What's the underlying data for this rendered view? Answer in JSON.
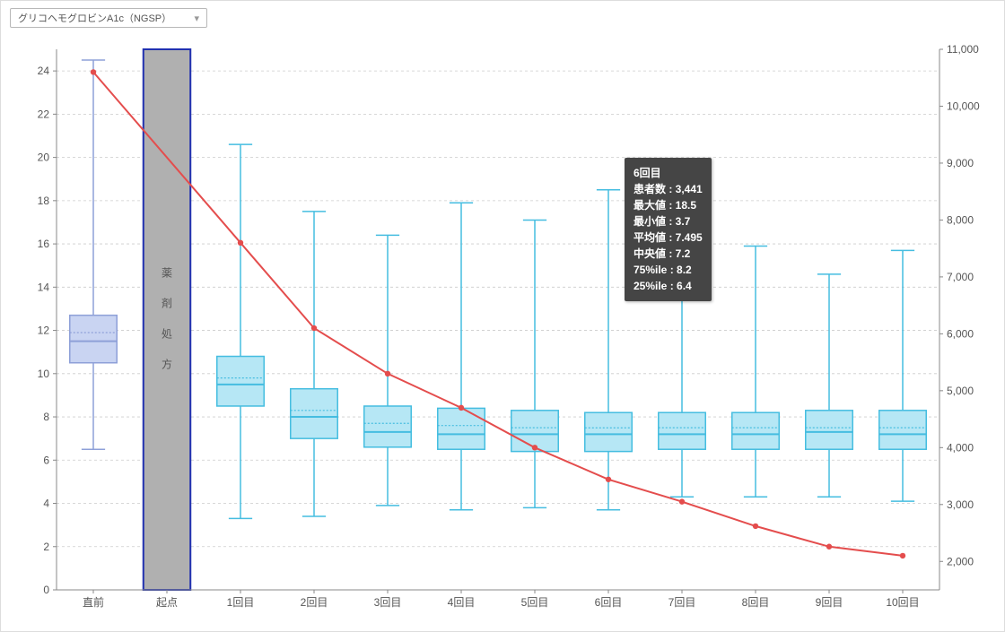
{
  "dropdown": {
    "selected": "グリコヘモグロビンA1c（NGSP）"
  },
  "chart_data": {
    "type": "boxplot+line",
    "x_categories": [
      "直前",
      "起点",
      "1回目",
      "2回目",
      "3回目",
      "4回目",
      "5回目",
      "6回目",
      "7回目",
      "8回目",
      "9回目",
      "10回目"
    ],
    "y1": {
      "label": "",
      "ylim": [
        0,
        25
      ],
      "ticks": [
        0,
        2,
        4,
        6,
        8,
        10,
        12,
        14,
        16,
        18,
        20,
        22,
        24
      ]
    },
    "y2": {
      "label": "",
      "ylim": [
        1500,
        11000
      ],
      "ticks": [
        2000,
        3000,
        4000,
        5000,
        6000,
        7000,
        8000,
        9000,
        10000,
        11000
      ],
      "tick_labels": [
        "2,000",
        "3,000",
        "4,000",
        "5,000",
        "6,000",
        "7,000",
        "8,000",
        "9,000",
        "10,000",
        "11,000"
      ]
    },
    "reference_band": {
      "category": "起点",
      "label": "薬剤処方"
    },
    "boxes": [
      {
        "cat": "直前",
        "min": 6.5,
        "q1": 10.5,
        "median": 11.5,
        "mean": 11.9,
        "q3": 12.7,
        "max": 24.5,
        "style": "pre"
      },
      {
        "cat": "1回目",
        "min": 3.3,
        "q1": 8.5,
        "median": 9.5,
        "mean": 9.8,
        "q3": 10.8,
        "max": 20.6,
        "style": "post"
      },
      {
        "cat": "2回目",
        "min": 3.4,
        "q1": 7.0,
        "median": 8.0,
        "mean": 8.3,
        "q3": 9.3,
        "max": 17.5,
        "style": "post"
      },
      {
        "cat": "3回目",
        "min": 3.9,
        "q1": 6.6,
        "median": 7.3,
        "mean": 7.7,
        "q3": 8.5,
        "max": 16.4,
        "style": "post"
      },
      {
        "cat": "4回目",
        "min": 3.7,
        "q1": 6.5,
        "median": 7.2,
        "mean": 7.6,
        "q3": 8.4,
        "max": 17.9,
        "style": "post"
      },
      {
        "cat": "5回目",
        "min": 3.8,
        "q1": 6.4,
        "median": 7.2,
        "mean": 7.5,
        "q3": 8.3,
        "max": 17.1,
        "style": "post"
      },
      {
        "cat": "6回目",
        "min": 3.7,
        "q1": 6.4,
        "median": 7.2,
        "mean": 7.495,
        "q3": 8.2,
        "max": 18.5,
        "style": "post"
      },
      {
        "cat": "7回目",
        "min": 4.3,
        "q1": 6.5,
        "median": 7.2,
        "mean": 7.5,
        "q3": 8.2,
        "max": 16.4,
        "style": "post"
      },
      {
        "cat": "8回目",
        "min": 4.3,
        "q1": 6.5,
        "median": 7.2,
        "mean": 7.5,
        "q3": 8.2,
        "max": 15.9,
        "style": "post"
      },
      {
        "cat": "9回目",
        "min": 4.3,
        "q1": 6.5,
        "median": 7.3,
        "mean": 7.5,
        "q3": 8.3,
        "max": 14.6,
        "style": "post"
      },
      {
        "cat": "10回目",
        "min": 4.1,
        "q1": 6.5,
        "median": 7.2,
        "mean": 7.5,
        "q3": 8.3,
        "max": 15.7,
        "style": "post"
      }
    ],
    "line_series": {
      "name": "患者数",
      "axis": "y2",
      "points": [
        {
          "cat": "直前",
          "y": 10600
        },
        {
          "cat": "1回目",
          "y": 7600
        },
        {
          "cat": "2回目",
          "y": 6100
        },
        {
          "cat": "3回目",
          "y": 5300
        },
        {
          "cat": "4回目",
          "y": 4700
        },
        {
          "cat": "5回目",
          "y": 4000
        },
        {
          "cat": "6回目",
          "y": 3441
        },
        {
          "cat": "7回目",
          "y": 3050
        },
        {
          "cat": "8回目",
          "y": 2620
        },
        {
          "cat": "9回目",
          "y": 2260
        },
        {
          "cat": "10回目",
          "y": 2100
        }
      ]
    }
  },
  "tooltip": {
    "title": "6回目",
    "rows": [
      {
        "k": "患者数",
        "v": "3,441"
      },
      {
        "k": "最大値",
        "v": "18.5"
      },
      {
        "k": "最小値",
        "v": "3.7"
      },
      {
        "k": "平均値",
        "v": "7.495"
      },
      {
        "k": "中央値",
        "v": "7.2"
      },
      {
        "k": "75%ile",
        "v": "8.2"
      },
      {
        "k": "25%ile",
        "v": "6.4"
      }
    ],
    "anchor_category": "6回目"
  }
}
